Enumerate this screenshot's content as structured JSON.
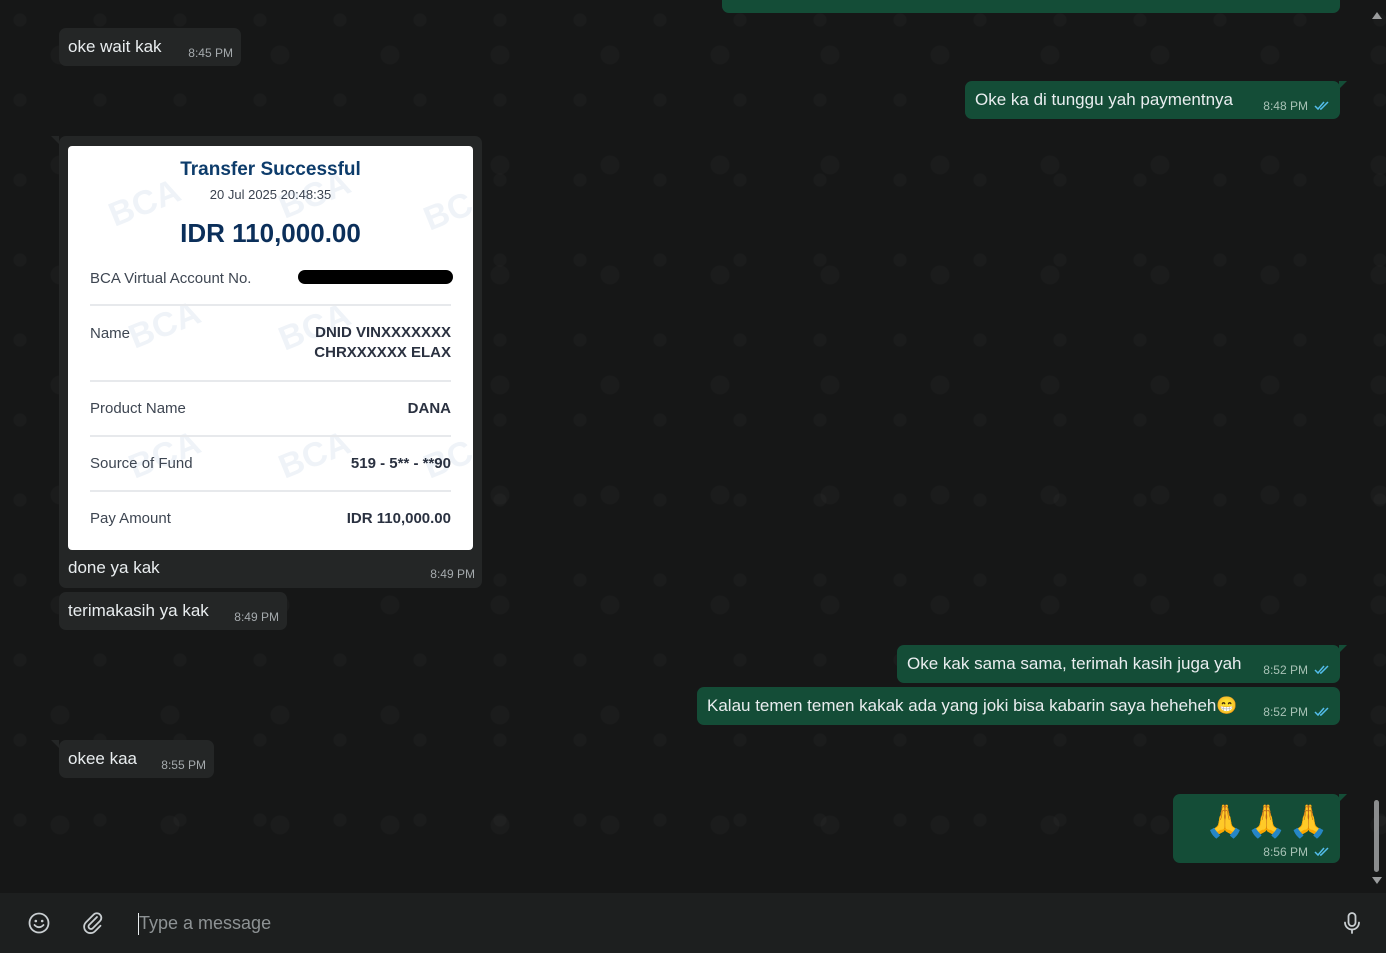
{
  "chat": {
    "messages": [
      {
        "id": "m1",
        "direction": "incoming",
        "text": "oke wait kak",
        "time": "8:45 PM"
      },
      {
        "id": "m2",
        "direction": "outgoing",
        "text": "Oke ka di tunggu yah paymentnya",
        "time": "8:48 PM",
        "status": "read"
      },
      {
        "id": "m3",
        "direction": "incoming",
        "type": "image",
        "caption": "done ya kak",
        "time": "8:49 PM"
      },
      {
        "id": "m4",
        "direction": "incoming",
        "text": "terimakasih ya kak",
        "time": "8:49 PM"
      },
      {
        "id": "m5",
        "direction": "outgoing",
        "text": "Oke kak sama sama, terimah kasih juga yah",
        "time": "8:52 PM",
        "status": "read"
      },
      {
        "id": "m6",
        "direction": "outgoing",
        "text": "Kalau temen temen kakak ada yang joki bisa kabarin saya heheheh😁",
        "time": "8:52 PM",
        "status": "read"
      },
      {
        "id": "m7",
        "direction": "incoming",
        "text": "okee kaa",
        "time": "8:55 PM"
      },
      {
        "id": "m8",
        "direction": "outgoing",
        "text": "🙏🙏🙏",
        "time": "8:56 PM",
        "status": "read"
      }
    ]
  },
  "receipt": {
    "title": "Transfer Successful",
    "datetime": "20 Jul 2025 20:48:35",
    "amount": "IDR 110,000.00",
    "watermark": "BCA",
    "rows": [
      {
        "label": "BCA Virtual Account No.",
        "value": ""
      },
      {
        "label": "Name",
        "value_line1": "DNID VINXXXXXXX",
        "value_line2": "CHRXXXXXX ELAX"
      },
      {
        "label": "Product Name",
        "value": "DANA"
      },
      {
        "label": "Source of Fund",
        "value": "519 - 5** - **90"
      },
      {
        "label": "Pay Amount",
        "value": "IDR 110,000.00"
      }
    ]
  },
  "composer": {
    "placeholder": "Type a message",
    "emoji_icon": "emoji-icon",
    "attach_icon": "paperclip-icon",
    "mic_icon": "microphone-icon"
  },
  "colors": {
    "background": "#161717",
    "incoming_bubble": "#242626",
    "outgoing_bubble": "#144d37",
    "read_ticks": "#53bdeb"
  }
}
